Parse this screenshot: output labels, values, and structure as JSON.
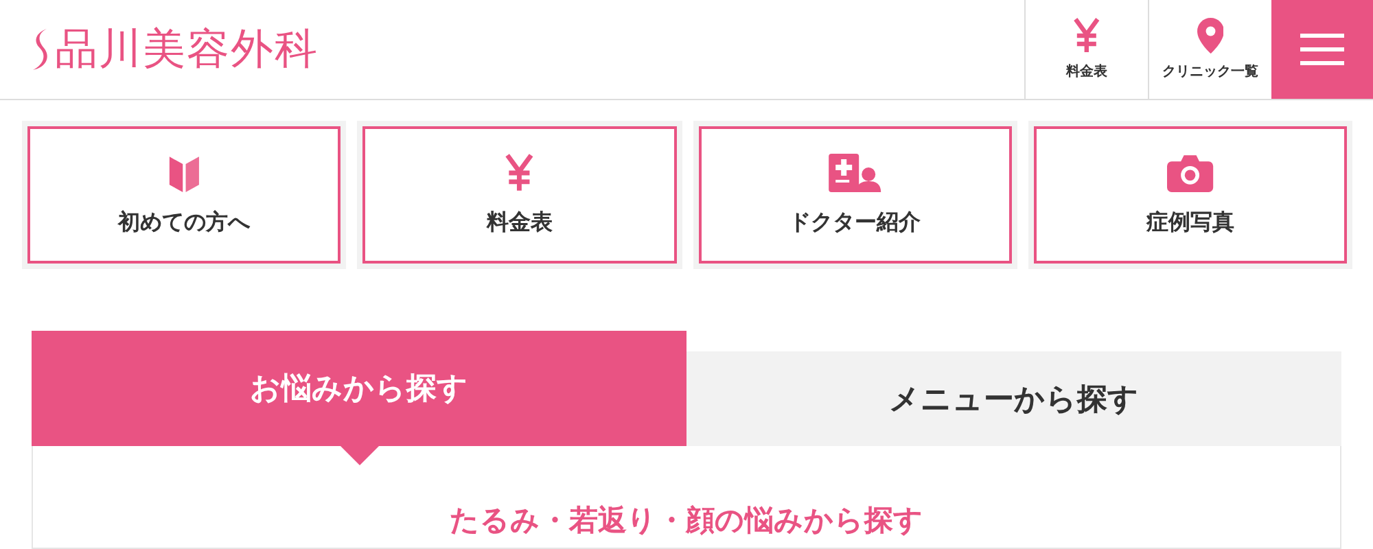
{
  "header": {
    "logo": "品川美容外科",
    "actions": [
      {
        "label": "料金表"
      },
      {
        "label": "クリニック一覧"
      }
    ]
  },
  "quick_links": [
    {
      "label": "初めての方へ"
    },
    {
      "label": "料金表"
    },
    {
      "label": "ドクター紹介"
    },
    {
      "label": "症例写真"
    }
  ],
  "tabs": [
    {
      "label": "お悩みから探す",
      "selected": true
    },
    {
      "label": "メニューから探す",
      "selected": false
    }
  ],
  "panel": {
    "heading": "たるみ・若返り・顔の悩みから探す"
  }
}
